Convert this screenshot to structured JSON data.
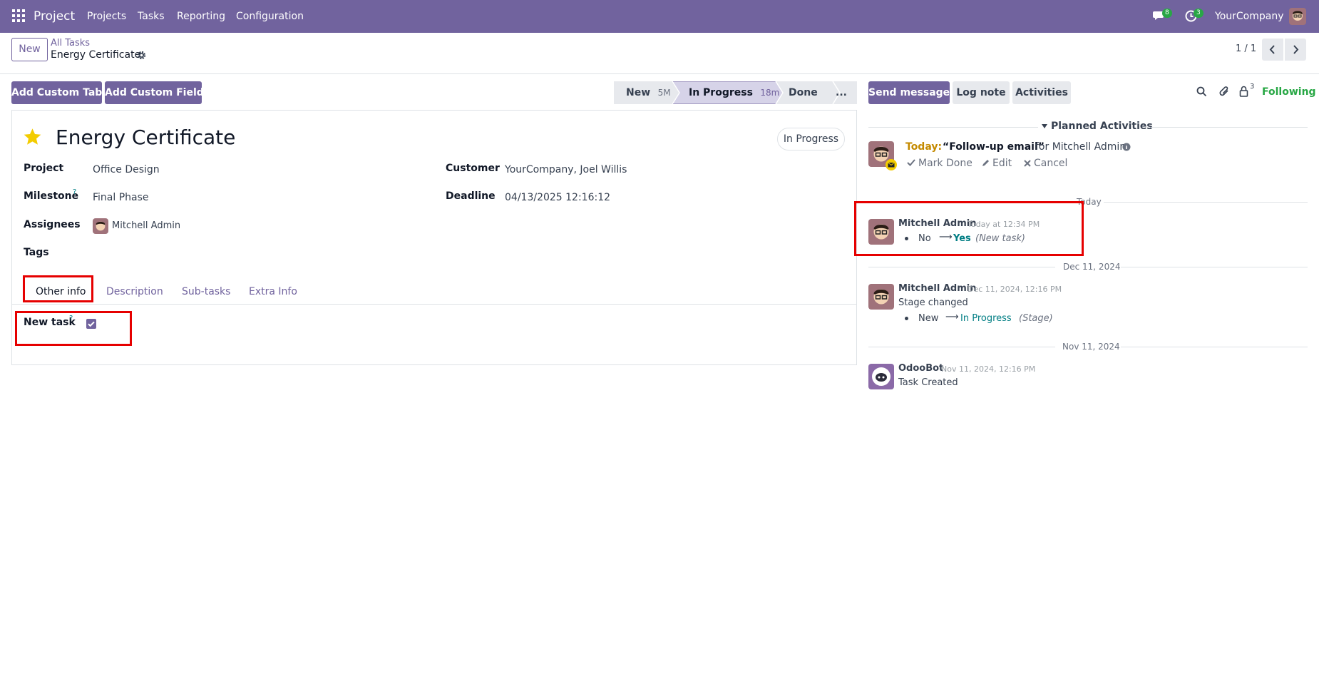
{
  "navbar": {
    "app_name": "Project",
    "menus": [
      "Projects",
      "Tasks",
      "Reporting",
      "Configuration"
    ],
    "messages_count": "8",
    "activities_count": "3",
    "company": "YourCompany"
  },
  "control_panel": {
    "new_label": "New",
    "breadcrumb_parent": "All Tasks",
    "breadcrumb_current": "Energy Certificate",
    "pager": "1 / 1"
  },
  "toolbar": {
    "add_custom_tab": "Add Custom Tab",
    "add_custom_field": "Add Custom Field"
  },
  "stages": [
    {
      "name": "New",
      "time": "5M"
    },
    {
      "name": "In Progress",
      "time": "18m"
    },
    {
      "name": "Done",
      "time": ""
    },
    {
      "name": "...",
      "time": ""
    }
  ],
  "form": {
    "title": "Energy Certificate",
    "state_badge": "In Progress",
    "project_label": "Project",
    "project_value": "Office Design",
    "milestone_label": "Milestone",
    "milestone_value": "Final Phase",
    "assignees_label": "Assignees",
    "assignees_value": "Mitchell Admin",
    "tags_label": "Tags",
    "customer_label": "Customer",
    "customer_value": "YourCompany, Joel Willis",
    "deadline_label": "Deadline",
    "deadline_value": "04/13/2025 12:16:12",
    "help_mark": "?",
    "tabs": [
      "Other info",
      "Description",
      "Sub-tasks",
      "Extra Info"
    ],
    "new_task_label": "New task",
    "new_task_checked": true
  },
  "chatter": {
    "send_message": "Send message",
    "log_note": "Log note",
    "activities": "Activities",
    "followers_count": "3",
    "following": "Following",
    "planned_title": "Planned Activities",
    "activity": {
      "when": "Today:",
      "summary": "“Follow-up email”",
      "for_text": "for Mitchell Admin",
      "mark_done": "Mark Done",
      "edit": "Edit",
      "cancel": "Cancel"
    },
    "sep_today": "Today",
    "msg1": {
      "author": "Mitchell Admin",
      "date": "Today at 12:34 PM",
      "old": "No",
      "new": "Yes",
      "field": "(New task)"
    },
    "sep_dec": "Dec 11, 2024",
    "msg2": {
      "author": "Mitchell Admin",
      "date": "Dec 11, 2024, 12:16 PM",
      "body": "Stage changed",
      "old": "New",
      "new": "In Progress",
      "field": "(Stage)"
    },
    "sep_nov": "Nov 11, 2024",
    "msg3": {
      "author": "OdooBot",
      "date": "Nov 11, 2024, 12:16 PM",
      "body": "Task Created"
    }
  },
  "colors": {
    "primary": "#71639e",
    "star": "#f3cc00",
    "link": "#017e84",
    "success": "#28a745",
    "highlight": "#e60000"
  }
}
